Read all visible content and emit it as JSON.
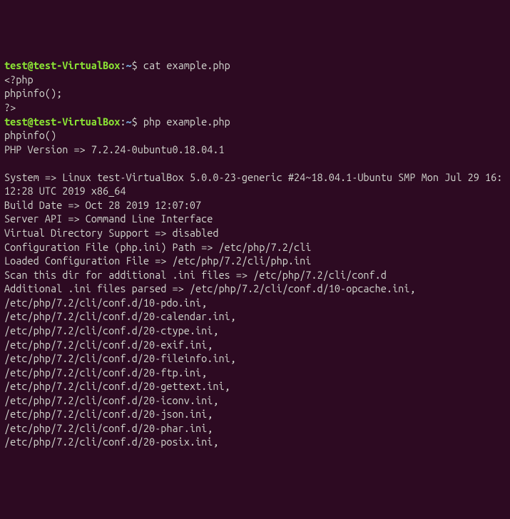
{
  "prompt1": {
    "userhost": "test@test-VirtualBox",
    "colon": ":",
    "path": "~",
    "dollar": "$ ",
    "cmd": "cat example.php"
  },
  "cat_output": {
    "l1": "<?php",
    "l2": "phpinfo();",
    "l3": "?>"
  },
  "prompt2": {
    "userhost": "test@test-VirtualBox",
    "colon": ":",
    "path": "~",
    "dollar": "$ ",
    "cmd": "php example.php"
  },
  "php_output": {
    "l1": "phpinfo()",
    "l2": "PHP Version => 7.2.24-0ubuntu0.18.04.1",
    "blank1": "",
    "l3": "System => Linux test-VirtualBox 5.0.0-23-generic #24~18.04.1-Ubuntu SMP Mon Jul 29 16:12:28 UTC 2019 x86_64",
    "l4": "Build Date => Oct 28 2019 12:07:07",
    "l5": "Server API => Command Line Interface",
    "l6": "Virtual Directory Support => disabled",
    "l7": "Configuration File (php.ini) Path => /etc/php/7.2/cli",
    "l8": "Loaded Configuration File => /etc/php/7.2/cli/php.ini",
    "l9": "Scan this dir for additional .ini files => /etc/php/7.2/cli/conf.d",
    "l10": "Additional .ini files parsed => /etc/php/7.2/cli/conf.d/10-opcache.ini,",
    "l11": "/etc/php/7.2/cli/conf.d/10-pdo.ini,",
    "l12": "/etc/php/7.2/cli/conf.d/20-calendar.ini,",
    "l13": "/etc/php/7.2/cli/conf.d/20-ctype.ini,",
    "l14": "/etc/php/7.2/cli/conf.d/20-exif.ini,",
    "l15": "/etc/php/7.2/cli/conf.d/20-fileinfo.ini,",
    "l16": "/etc/php/7.2/cli/conf.d/20-ftp.ini,",
    "l17": "/etc/php/7.2/cli/conf.d/20-gettext.ini,",
    "l18": "/etc/php/7.2/cli/conf.d/20-iconv.ini,",
    "l19": "/etc/php/7.2/cli/conf.d/20-json.ini,",
    "l20": "/etc/php/7.2/cli/conf.d/20-phar.ini,",
    "l21": "/etc/php/7.2/cli/conf.d/20-posix.ini,"
  }
}
